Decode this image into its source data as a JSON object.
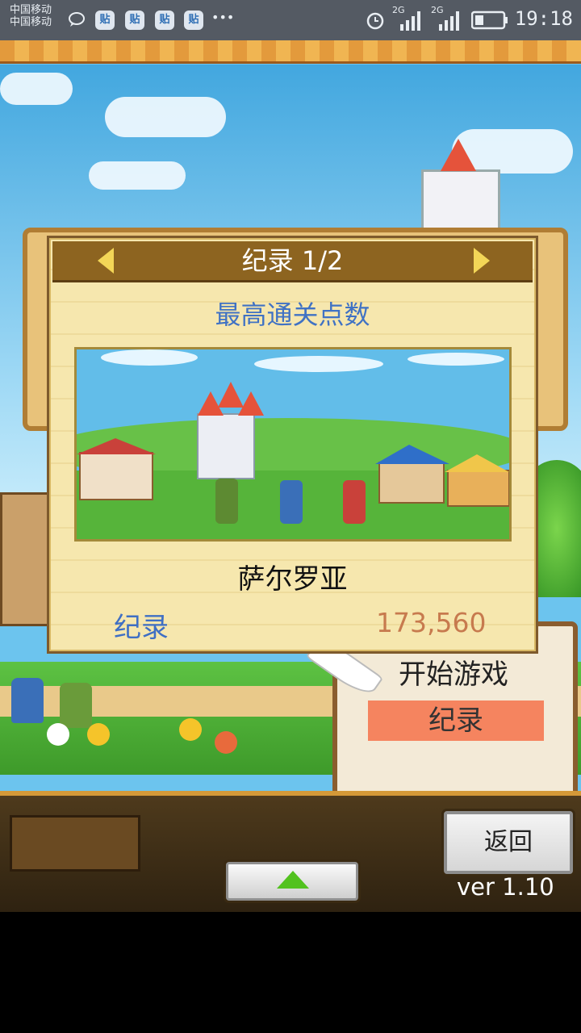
{
  "status_bar": {
    "carrier_line1": "中国移动",
    "carrier_line2": "中国移动",
    "notif_icon_text": "贴",
    "more": "•••",
    "signal1_label": "2G",
    "signal2_label": "2G",
    "time": "19:18"
  },
  "dialog": {
    "title": "纪录 1/2",
    "subtitle": "最高通关点数",
    "town_name": "萨尔罗亚",
    "record_label": "纪录",
    "record_value": "173,560"
  },
  "menu": {
    "start_label": "开始游戏",
    "record_label": "纪录"
  },
  "footer": {
    "back_label": "返回",
    "version": "ver 1.10"
  },
  "colors": {
    "title_bar": "#8d6420",
    "subtitle": "#4072c4",
    "record_value": "#c77a4e",
    "menu_highlight": "#f5845f"
  }
}
